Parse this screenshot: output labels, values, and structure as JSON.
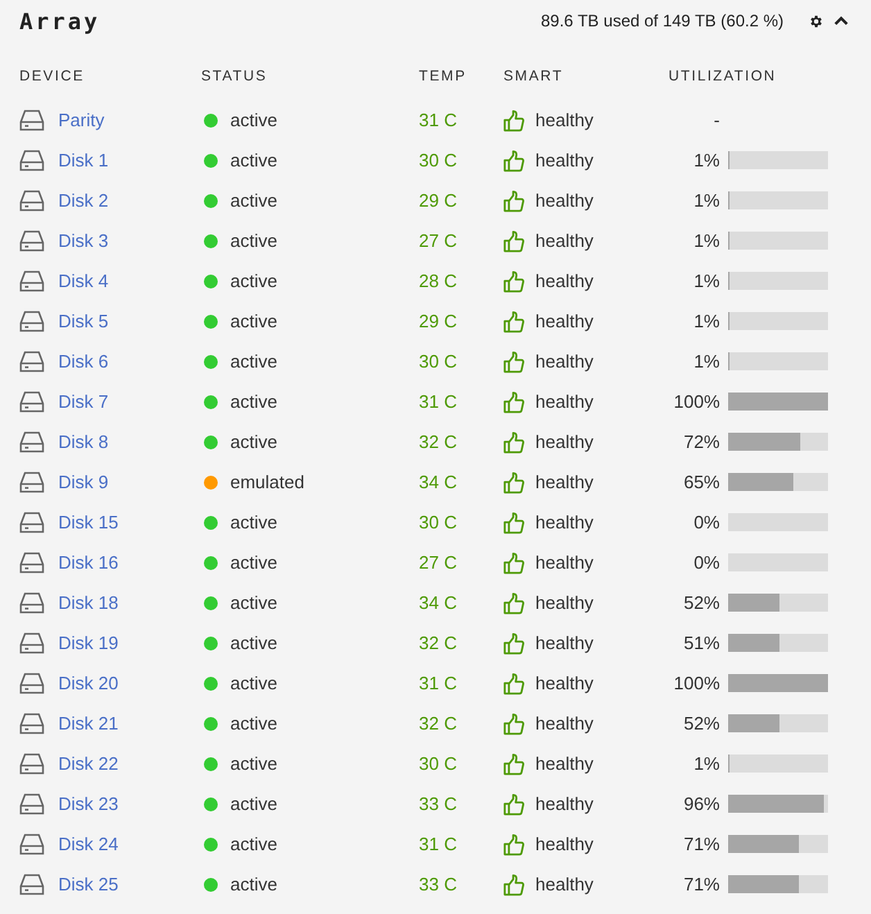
{
  "panel": {
    "title": "Array",
    "summary": "89.6 TB used of 149 TB (60.2 %)"
  },
  "table": {
    "columns": [
      "DEVICE",
      "STATUS",
      "TEMP",
      "SMART",
      "UTILIZATION"
    ],
    "rows": [
      {
        "device": "Parity",
        "status": "active",
        "color": "#33cc33",
        "temp": "31 C",
        "smart": "healthy",
        "utilization": "-"
      },
      {
        "device": "Disk 1",
        "status": "active",
        "color": "#33cc33",
        "temp": "30 C",
        "smart": "healthy",
        "utilization": "1%",
        "level": 0.01
      },
      {
        "device": "Disk 2",
        "status": "active",
        "color": "#33cc33",
        "temp": "29 C",
        "smart": "healthy",
        "utilization": "1%",
        "level": 0.01
      },
      {
        "device": "Disk 3",
        "status": "active",
        "color": "#33cc33",
        "temp": "27 C",
        "smart": "healthy",
        "utilization": "1%",
        "level": 0.01
      },
      {
        "device": "Disk 4",
        "status": "active",
        "color": "#33cc33",
        "temp": "28 C",
        "smart": "healthy",
        "utilization": "1%",
        "level": 0.01
      },
      {
        "device": "Disk 5",
        "status": "active",
        "color": "#33cc33",
        "temp": "29 C",
        "smart": "healthy",
        "utilization": "1%",
        "level": 0.01
      },
      {
        "device": "Disk 6",
        "status": "active",
        "color": "#33cc33",
        "temp": "30 C",
        "smart": "healthy",
        "utilization": "1%",
        "level": 0.01
      },
      {
        "device": "Disk 7",
        "status": "active",
        "color": "#33cc33",
        "temp": "31 C",
        "smart": "healthy",
        "utilization": "100%",
        "level": 1
      },
      {
        "device": "Disk 8",
        "status": "active",
        "color": "#33cc33",
        "temp": "32 C",
        "smart": "healthy",
        "utilization": "72%",
        "level": 0.72
      },
      {
        "device": "Disk 9",
        "status": "emulated",
        "color": "#ff9900",
        "temp": "34 C",
        "smart": "healthy",
        "utilization": "65%",
        "level": 0.65
      },
      {
        "device": "Disk 15",
        "status": "active",
        "color": "#33cc33",
        "temp": "30 C",
        "smart": "healthy",
        "utilization": "0%",
        "level": 0
      },
      {
        "device": "Disk 16",
        "status": "active",
        "color": "#33cc33",
        "temp": "27 C",
        "smart": "healthy",
        "utilization": "0%",
        "level": 0
      },
      {
        "device": "Disk 18",
        "status": "active",
        "color": "#33cc33",
        "temp": "34 C",
        "smart": "healthy",
        "utilization": "52%",
        "level": 0.52
      },
      {
        "device": "Disk 19",
        "status": "active",
        "color": "#33cc33",
        "temp": "32 C",
        "smart": "healthy",
        "utilization": "51%",
        "level": 0.51
      },
      {
        "device": "Disk 20",
        "status": "active",
        "color": "#33cc33",
        "temp": "31 C",
        "smart": "healthy",
        "utilization": "100%",
        "level": 1
      },
      {
        "device": "Disk 21",
        "status": "active",
        "color": "#33cc33",
        "temp": "32 C",
        "smart": "healthy",
        "utilization": "52%",
        "level": 0.52
      },
      {
        "device": "Disk 22",
        "status": "active",
        "color": "#33cc33",
        "temp": "30 C",
        "smart": "healthy",
        "utilization": "1%",
        "level": 0.01
      },
      {
        "device": "Disk 23",
        "status": "active",
        "color": "#33cc33",
        "temp": "33 C",
        "smart": "healthy",
        "utilization": "96%",
        "level": 0.96
      },
      {
        "device": "Disk 24",
        "status": "active",
        "color": "#33cc33",
        "temp": "31 C",
        "smart": "healthy",
        "utilization": "71%",
        "level": 0.71
      },
      {
        "device": "Disk 25",
        "status": "active",
        "color": "#33cc33",
        "temp": "33 C",
        "smart": "healthy",
        "utilization": "71%",
        "level": 0.71
      }
    ]
  }
}
